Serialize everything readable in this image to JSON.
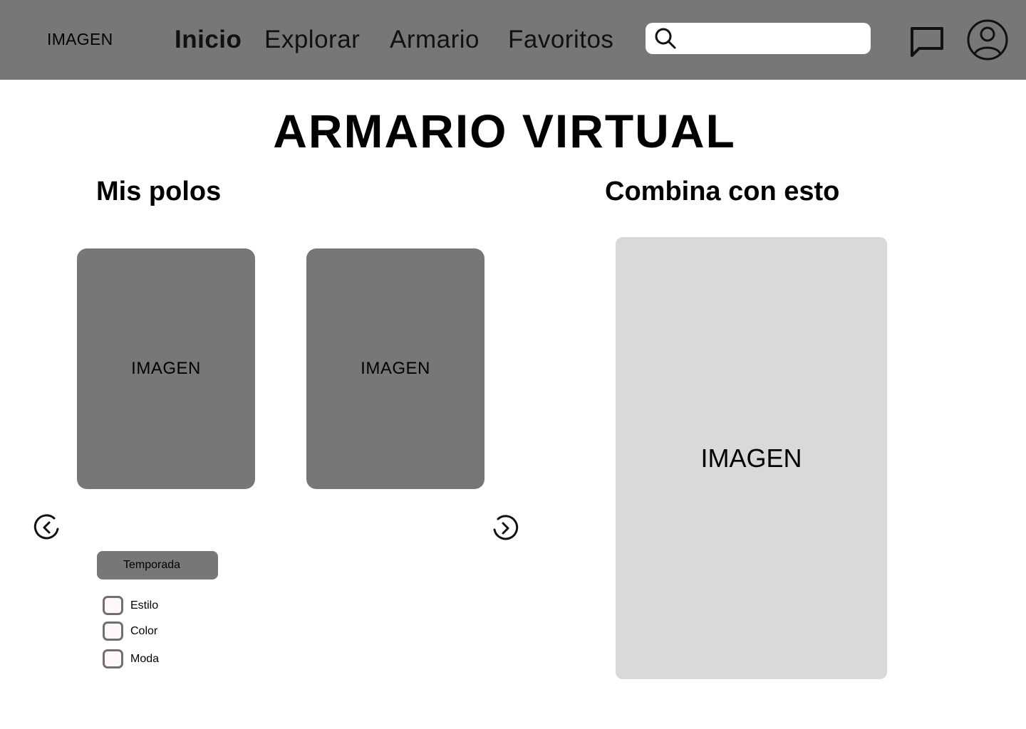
{
  "header": {
    "logo": "IMAGEN",
    "nav": [
      "Inicio",
      "Explorar",
      "Armario",
      "Favoritos"
    ],
    "active_nav": "Inicio",
    "search_value": "",
    "icons": [
      "search-icon",
      "chat-icon",
      "user-icon"
    ]
  },
  "main": {
    "title": "ARMARIO VIRTUAL",
    "left_section_title": "Mis polos",
    "right_section_title": "Combina con esto",
    "cards": [
      "IMAGEN",
      "IMAGEN"
    ],
    "match_image": "IMAGEN",
    "carousel_icons": [
      "chevron-left-icon",
      "chevron-right-icon"
    ]
  },
  "filters": {
    "season_button": "Temporada",
    "options": [
      {
        "label": "Estilo",
        "checked": false
      },
      {
        "label": "Color",
        "checked": false
      },
      {
        "label": "Moda",
        "checked": false
      }
    ]
  },
  "colors": {
    "header_bg": "#777777",
    "card_bg": "#777777",
    "match_card_bg": "#d9d9d9",
    "checkbox_fill": "#fff7f8"
  }
}
